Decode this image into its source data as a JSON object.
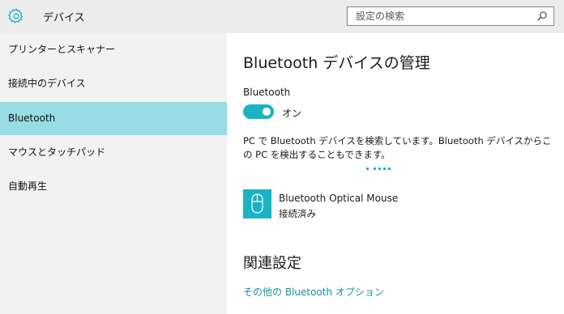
{
  "app": {
    "title": "デバイス"
  },
  "icons": {
    "app": "gear-icon",
    "search": "search-icon",
    "device": "mouse-icon"
  },
  "search": {
    "placeholder": "設定の検索",
    "value": ""
  },
  "sidebar": {
    "items": [
      {
        "label": "プリンターとスキャナー",
        "selected": false
      },
      {
        "label": "接続中のデバイス",
        "selected": false
      },
      {
        "label": "Bluetooth",
        "selected": true
      },
      {
        "label": "マウスとタッチパッド",
        "selected": false
      },
      {
        "label": "自動再生",
        "selected": false
      }
    ]
  },
  "main": {
    "title": "Bluetooth デバイスの管理",
    "bluetooth_label": "Bluetooth",
    "toggle": {
      "state": "on",
      "label": "オン"
    },
    "description": "PC で Bluetooth デバイスを検索しています。Bluetooth デバイスからこの PC を検出することもできます。",
    "devices": [
      {
        "name": "Bluetooth Optical Mouse",
        "status": "接続済み"
      }
    ],
    "related": {
      "heading": "関連設定",
      "link": "その他の Bluetooth オプション"
    }
  },
  "colors": {
    "accent": "#1bb3c3",
    "selected_nav": "#97dde3",
    "link": "#1a8fa3",
    "header_bg": "#ececec",
    "sidebar_bg": "#f2f2f2"
  }
}
